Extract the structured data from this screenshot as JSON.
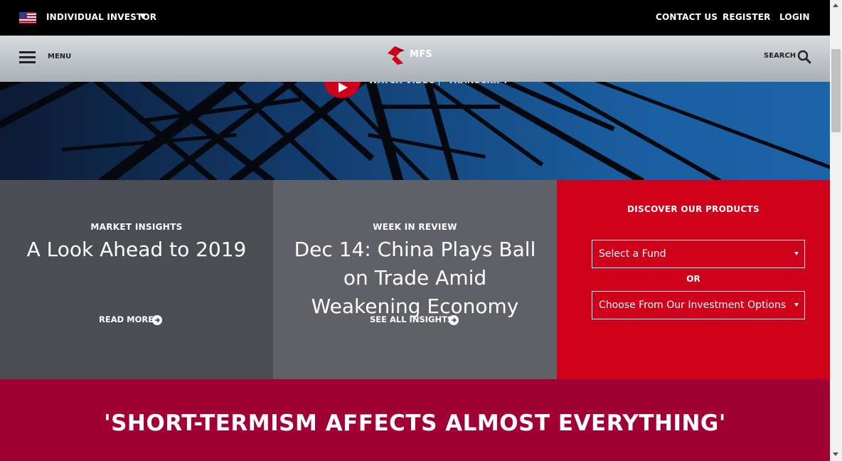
{
  "topbar": {
    "investor_label": "INDIVIDUAL INVESTOR",
    "links": [
      "CONTACT US",
      "REGISTER",
      "LOGIN"
    ]
  },
  "nav": {
    "menu_label": "MENU",
    "logo_text": "MFS",
    "search_label": "SEARCH"
  },
  "hero": {
    "watch_label": "WATCH VIDEO",
    "transcript_label": "TRANSCRIPT"
  },
  "panels": {
    "insights": {
      "kicker": "MARKET INSIGHTS",
      "headline": "A Look Ahead to 2019",
      "cta": "READ MORE"
    },
    "review": {
      "kicker": "WEEK IN REVIEW",
      "headline": "Dec 14: China Plays Ball on Trade Amid Weakening Economy",
      "cta": "SEE ALL INSIGHTS"
    },
    "products": {
      "title": "DISCOVER OUR PRODUCTS",
      "fund_select": "Select a Fund",
      "or_label": "OR",
      "options_select": "Choose From Our Investment Options"
    }
  },
  "bottom": {
    "quote": "'SHORT-TERMISM AFFECTS ALMOST EVERYTHING'"
  },
  "colors": {
    "brand_red": "#d0021b",
    "bottom_band": "#a00033",
    "panel_dark": "#4a4d52",
    "panel_mid": "#5f6166"
  },
  "icons": [
    "us-flag-icon",
    "caret-down-icon",
    "hamburger-icon",
    "mfs-logo-icon",
    "search-icon",
    "play-icon",
    "arrow-circle-right-icon",
    "chevron-down-icon"
  ]
}
